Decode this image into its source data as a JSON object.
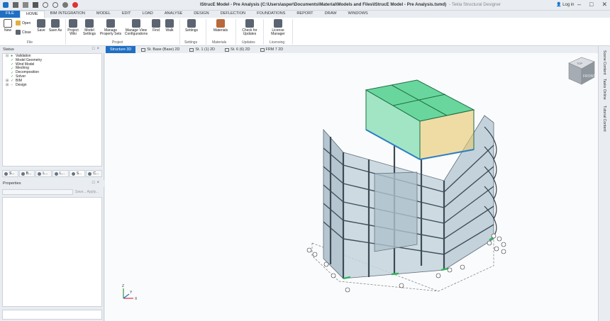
{
  "window": {
    "title_main": "IStrucE Model - Pre Analysis (C:\\Users\\asper\\Documents\\Material\\Models and Files\\IStrucE Model - Pre Analysis.tsmd)",
    "app_name": "- Tekla Structural Designer",
    "login_label": "Log in"
  },
  "menu_tabs": [
    "FILE",
    "HOME",
    "BIM INTEGRATION",
    "MODEL",
    "EDIT",
    "LOAD",
    "ANALYSE",
    "DESIGN",
    "DEFLECTION",
    "FOUNDATIONS",
    "REPORT",
    "DRAW",
    "WINDOWS"
  ],
  "ribbon": {
    "new": "New",
    "open": "Open",
    "close": "Close",
    "save": "Save",
    "save_as": "Save As",
    "project_wiki": "Project Wiki",
    "model_settings": "Model Settings",
    "manage_property_sets": "Manage Property Sets",
    "manage_view_configurations": "Manage View Configurations",
    "find": "Find",
    "walk": "Walk",
    "settings": "Settings",
    "materials": "Materials",
    "check_updates": "Check for Updates",
    "license_manager": "License Manager",
    "groups": {
      "file": "File",
      "project": "Project",
      "settings": "Settings",
      "materials": "Materials",
      "updates": "Updates",
      "licensing": "Licensing"
    }
  },
  "status_panel": {
    "title": "Status",
    "items": [
      "Validation",
      "Model Geometry",
      "Wind Model",
      "Meshing",
      "Decomposition",
      "Solver",
      "BIM",
      "Design"
    ]
  },
  "panel_tabs": [
    "S...",
    "B...",
    "L...",
    "L...",
    "S...",
    "C..."
  ],
  "properties_panel": {
    "title": "Properties",
    "save_apply": "Save... Apply..."
  },
  "view_tabs": [
    "Structure 3D",
    "St. Base (Base) 2D",
    "St. 1 (1) 2D",
    "St. 6 (6) 2D",
    "FRM 7 2D"
  ],
  "right_tabs": [
    "Scene Content",
    "Tasks Online",
    "Tutorial Content"
  ],
  "viewcube": {
    "top": "TOP",
    "front": "FRONT"
  },
  "axes": {
    "x": "X",
    "y": "Y",
    "z": "Z"
  },
  "colors": {
    "accent": "#1f6fc4",
    "slab_green": "#3ec27c",
    "wall": "#a9bcc8"
  }
}
